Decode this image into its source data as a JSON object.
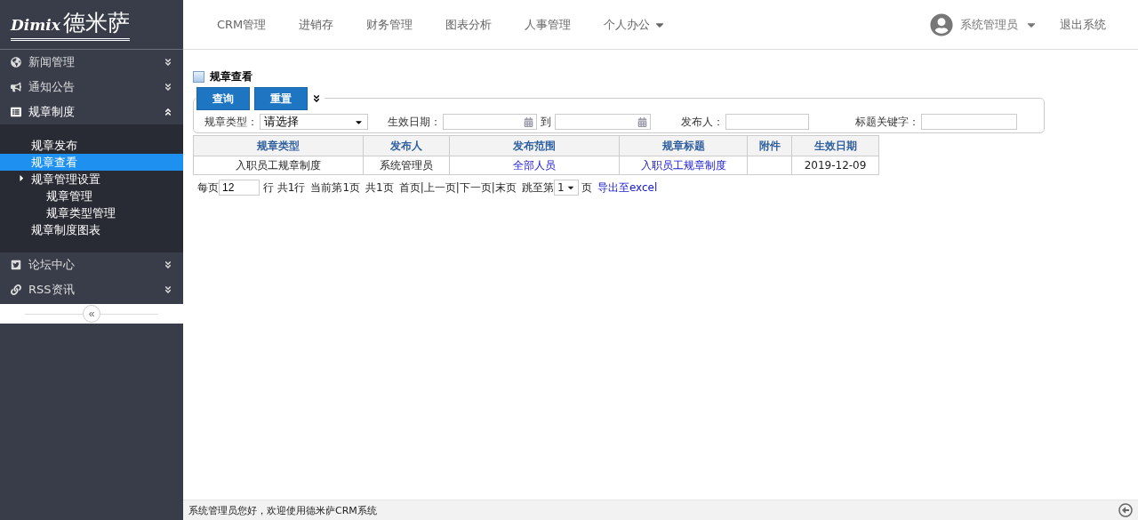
{
  "logo": {
    "mark": "Dimix",
    "name": "德米萨"
  },
  "nav": [
    {
      "label": "CRM管理",
      "dropdown": false
    },
    {
      "label": "进销存",
      "dropdown": false
    },
    {
      "label": "财务管理",
      "dropdown": false
    },
    {
      "label": "图表分析",
      "dropdown": false
    },
    {
      "label": "人事管理",
      "dropdown": false
    },
    {
      "label": "个人办公",
      "dropdown": true
    }
  ],
  "user": {
    "name": "系统管理员",
    "logout": "退出系统"
  },
  "sidebar": {
    "groups": [
      {
        "label": "新闻管理",
        "expanded": false
      },
      {
        "label": "通知公告",
        "expanded": false
      },
      {
        "label": "规章制度",
        "expanded": true,
        "children": [
          {
            "label": "规章发布",
            "selected": false
          },
          {
            "label": "规章查看",
            "selected": true
          },
          {
            "label": "规章管理设置",
            "selected": false,
            "children": [
              {
                "label": "规章管理",
                "selected": false
              },
              {
                "label": "规章类型管理",
                "selected": false
              }
            ]
          },
          {
            "label": "规章制度图表",
            "selected": false
          }
        ]
      },
      {
        "label": "论坛中心",
        "expanded": false
      },
      {
        "label": "RSS资讯",
        "expanded": false
      }
    ],
    "collapse": "«"
  },
  "page": {
    "title": "规章查看",
    "buttons": [
      "查询",
      "重置"
    ],
    "filters": {
      "type_label": "规章类型：",
      "type_value": "请选择",
      "date_label": "生效日期：",
      "date_to": "到",
      "publisher_label": "发布人：",
      "keyword_label": "标题关键字："
    },
    "table": {
      "columns": [
        "规章类型",
        "发布人",
        "发布范围",
        "规章标题",
        "附件",
        "生效日期"
      ],
      "rows": [
        [
          {
            "text": "入职员工规章制度",
            "kind": "text"
          },
          {
            "text": "系统管理员",
            "kind": "text"
          },
          {
            "text": "全部人员",
            "kind": "link"
          },
          {
            "text": "入职员工规章制度",
            "kind": "link"
          },
          {
            "kind": "empty"
          },
          {
            "text": "2019-12-09",
            "kind": "text"
          }
        ]
      ]
    },
    "pagination": {
      "per_page_label": "每页",
      "per_page": "12",
      "rows_label": "行 共1行",
      "current": "当前第1页",
      "total": "共1页",
      "links": [
        "首页",
        "上一页",
        "下一页",
        "末页"
      ],
      "separator": "|",
      "jump_label": "跳至第",
      "jump_value": "1",
      "page_label": "页",
      "export": "导出至excel"
    }
  },
  "status_bar": {
    "text": "系统管理员您好，欢迎使用德米萨CRM系统"
  }
}
